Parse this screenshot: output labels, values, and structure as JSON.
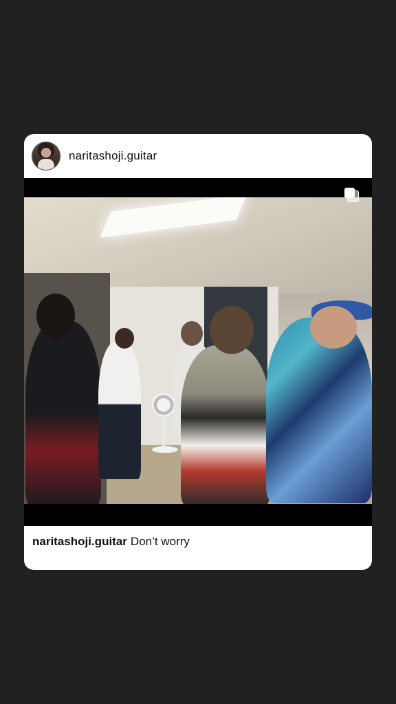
{
  "post": {
    "username": "naritashoji.guitar",
    "caption_username": "naritashoji.guitar",
    "caption_text": "Don’t worry",
    "media_icon": "multiple-photos-icon",
    "avatar_icon": "profile-avatar"
  },
  "colors": {
    "background": "#212121",
    "card": "#ffffff",
    "media_background": "#000000"
  }
}
